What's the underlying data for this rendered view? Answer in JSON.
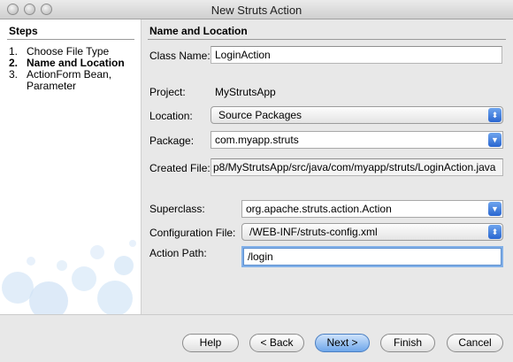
{
  "window": {
    "title": "New Struts Action"
  },
  "steps": {
    "heading": "Steps",
    "items": [
      {
        "num": "1.",
        "label": "Choose File Type"
      },
      {
        "num": "2.",
        "label": "Name and Location"
      },
      {
        "num": "3.",
        "label": "ActionForm Bean,",
        "cont": "Parameter"
      }
    ]
  },
  "panel": {
    "heading": "Name and Location"
  },
  "form": {
    "class_name": {
      "label": "Class Name:",
      "value": "LoginAction"
    },
    "project": {
      "label": "Project:",
      "value": "MyStrutsApp"
    },
    "location": {
      "label": "Location:",
      "value": "Source Packages"
    },
    "package": {
      "label": "Package:",
      "value": "com.myapp.struts"
    },
    "created_file": {
      "label": "Created File:",
      "value": "p8/MyStrutsApp/src/java/com/myapp/struts/LoginAction.java"
    },
    "superclass": {
      "label": "Superclass:",
      "value": "org.apache.struts.action.Action"
    },
    "config_file": {
      "label": "Configuration File:",
      "value": "/WEB-INF/struts-config.xml"
    },
    "action_path": {
      "label": "Action Path:",
      "value": "/login"
    }
  },
  "buttons": {
    "help": "Help",
    "back": "< Back",
    "next": "Next >",
    "finish": "Finish",
    "cancel": "Cancel"
  },
  "icons": {
    "popup_arrow": "⬍",
    "combo_arrow": "▼"
  },
  "colors": {
    "accent": "#2a66d0",
    "focus_ring": "#82b0e8"
  }
}
